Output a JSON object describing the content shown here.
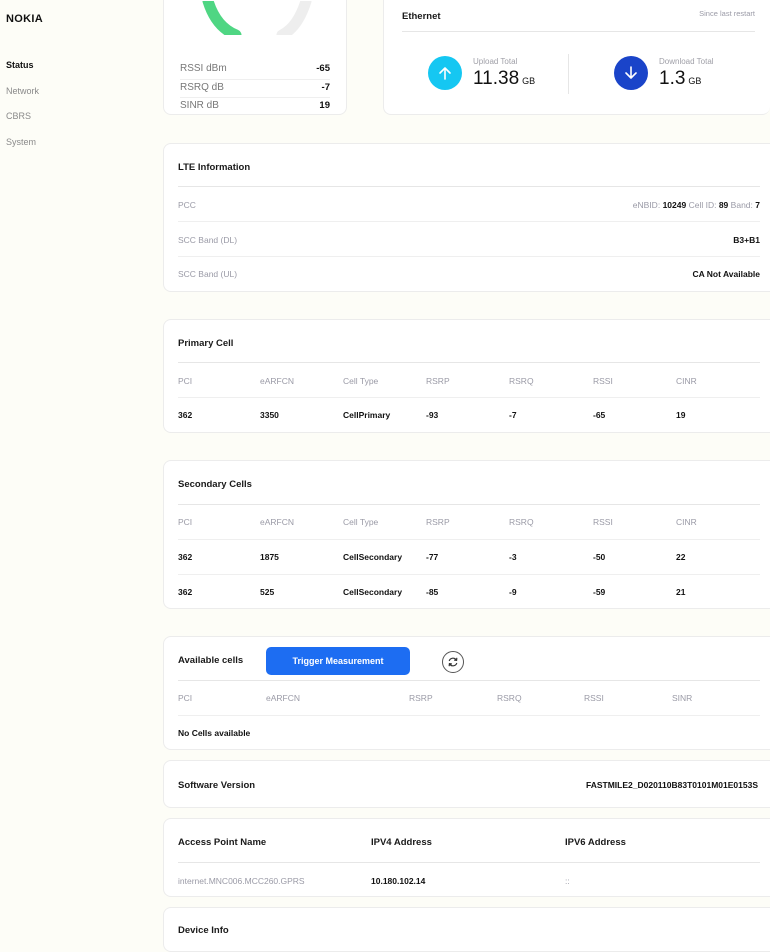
{
  "brand": "NOKIA",
  "sidebar": {
    "items": [
      "Status",
      "Network",
      "CBRS",
      "System"
    ],
    "active": 0
  },
  "signal": {
    "rows": [
      {
        "label": "RSSI dBm",
        "value": "-65"
      },
      {
        "label": "RSRQ dB",
        "value": "-7"
      },
      {
        "label": "SINR dB",
        "value": "19"
      }
    ]
  },
  "ethernet": {
    "title": "Ethernet",
    "since": "Since last restart",
    "upload": {
      "label": "Upload Total",
      "value": "11.38",
      "unit": "GB"
    },
    "download": {
      "label": "Download Total",
      "value": "1.3",
      "unit": "GB"
    }
  },
  "lte": {
    "title": "LTE Information",
    "pcc": {
      "label": "PCC",
      "enbid_label": "eNBID:",
      "enbid": "10249",
      "cellid_label": "Cell ID:",
      "cellid": "89",
      "band_label": "Band:",
      "band": "7"
    },
    "scc_dl": {
      "label": "SCC Band (DL)",
      "value": "B3+B1"
    },
    "scc_ul": {
      "label": "SCC Band (UL)",
      "value": "CA Not Available"
    }
  },
  "primary": {
    "title": "Primary Cell",
    "headers": [
      "PCI",
      "eARFCN",
      "Cell Type",
      "RSRP",
      "RSRQ",
      "RSSI",
      "CINR"
    ],
    "rows": [
      [
        "362",
        "3350",
        "CellPrimary",
        "-93",
        "-7",
        "-65",
        "19"
      ]
    ]
  },
  "secondary": {
    "title": "Secondary Cells",
    "headers": [
      "PCI",
      "eARFCN",
      "Cell Type",
      "RSRP",
      "RSRQ",
      "RSSI",
      "CINR"
    ],
    "rows": [
      [
        "362",
        "1875",
        "CellSecondary",
        "-77",
        "-3",
        "-50",
        "22"
      ],
      [
        "362",
        "525",
        "CellSecondary",
        "-85",
        "-9",
        "-59",
        "21"
      ]
    ]
  },
  "available": {
    "title": "Available cells",
    "button": "Trigger Measurement",
    "headers": [
      "PCI",
      "eARFCN",
      "RSRP",
      "RSRQ",
      "RSSI",
      "SINR"
    ],
    "empty": "No Cells available"
  },
  "software": {
    "title": "Software Version",
    "value": "FASTMILE2_D020110B83T0101M01E0153S"
  },
  "apn": {
    "headers": [
      "Access Point Name",
      "IPV4 Address",
      "IPV6 Address"
    ],
    "name": "internet.MNC006.MCC260.GPRS",
    "ipv4": "10.180.102.14",
    "ipv6": "::"
  },
  "device": {
    "title": "Device Info"
  },
  "colors": {
    "upload": "#15c7f2",
    "download": "#1a44c9",
    "button": "#1d6df2",
    "gauge": "#4fd683"
  }
}
